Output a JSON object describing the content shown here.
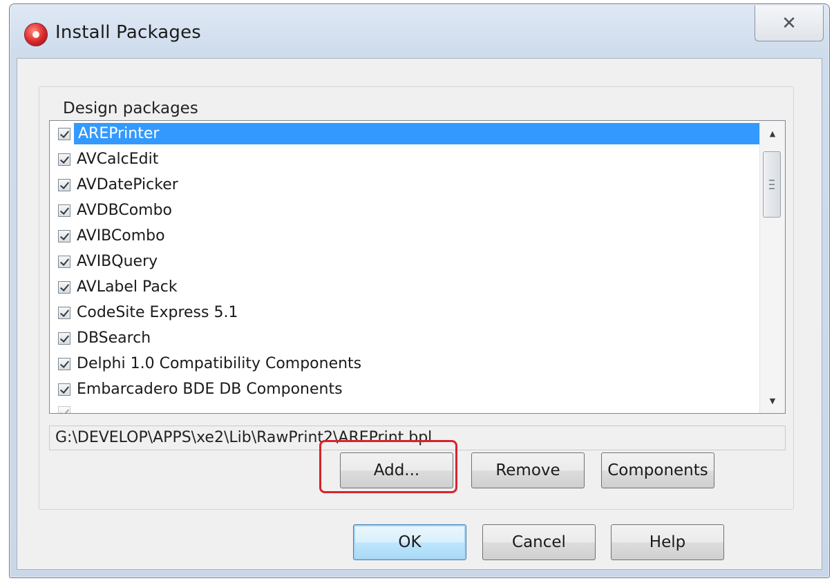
{
  "window": {
    "title": "Install Packages",
    "close_glyph": "✕",
    "app_icon": "delphi-icon"
  },
  "group": {
    "label": "Design packages"
  },
  "packages": [
    {
      "label": "AREPrinter",
      "checked": true,
      "selected": true
    },
    {
      "label": "AVCalcEdit",
      "checked": true
    },
    {
      "label": "AVDatePicker",
      "checked": true
    },
    {
      "label": "AVDBCombo",
      "checked": true
    },
    {
      "label": "AVIBCombo",
      "checked": true
    },
    {
      "label": "AVIBQuery",
      "checked": true
    },
    {
      "label": "AVLabel Pack",
      "checked": true
    },
    {
      "label": "CodeSite Express 5.1",
      "checked": true
    },
    {
      "label": "DBSearch",
      "checked": true
    },
    {
      "label": "Delphi 1.0 Compatibility Components",
      "checked": true
    },
    {
      "label": "Embarcadero BDE DB Components",
      "checked": true
    }
  ],
  "selected_path": "G:\\DEVELOP\\APPS\\xe2\\Lib\\RawPrint2\\AREPrint.bpl",
  "buttons": {
    "add": "Add...",
    "remove": "Remove",
    "components": "Components",
    "ok": "OK",
    "cancel": "Cancel",
    "help": "Help"
  },
  "colors": {
    "selection": "#3399ff",
    "highlight_ring": "#d8232a"
  }
}
